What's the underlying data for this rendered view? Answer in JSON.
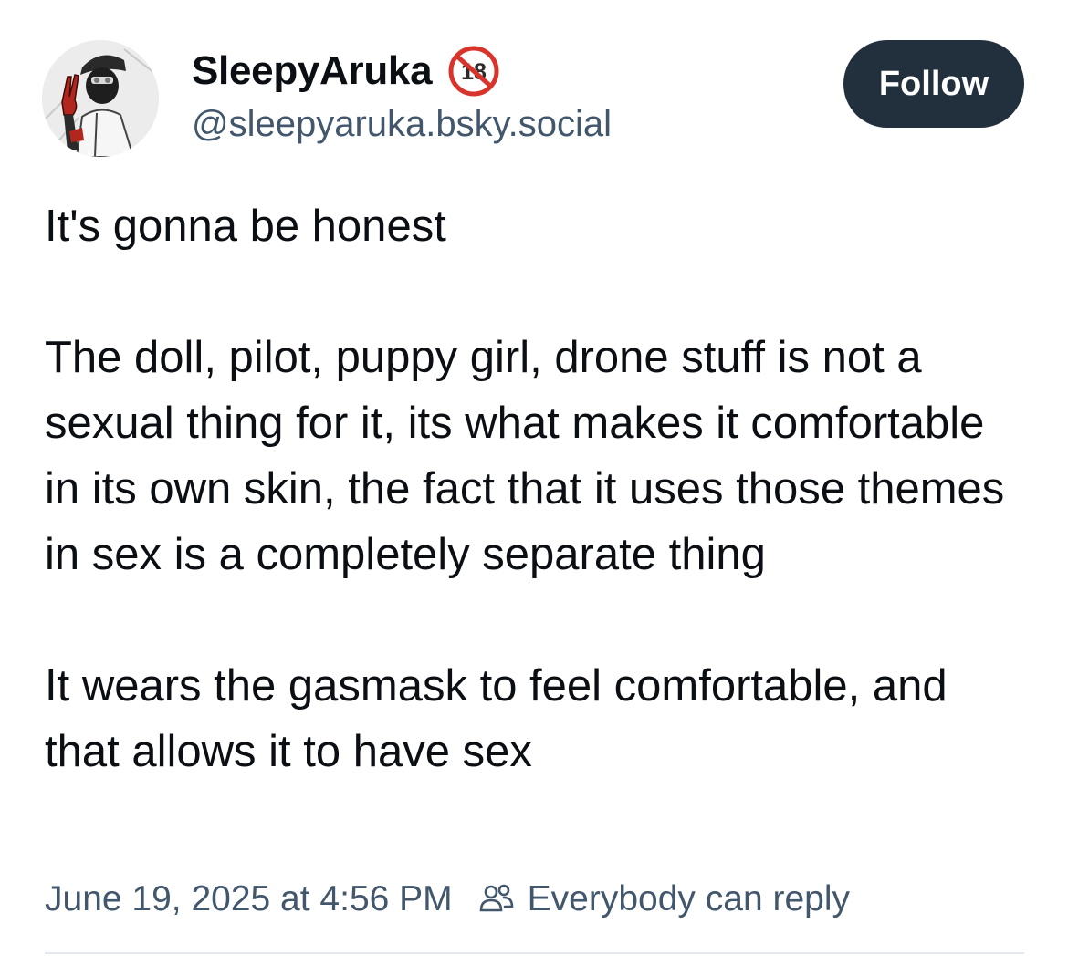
{
  "author": {
    "display_name": "SleepyAruka",
    "handle": "@sleepyaruka.bsky.social",
    "adult_badge": "18",
    "badge_icon": "no-under-18-icon",
    "avatar_icon": "avatar-masked-figure-peace-sign"
  },
  "follow_button": {
    "label": "Follow"
  },
  "post": {
    "paragraphs": [
      "It's gonna be honest",
      "The doll, pilot, puppy girl, drone stuff is not a sexual thing for it, its what makes it comfortable in its own skin, the fact that it uses those themes in sex is a completely separate thing",
      "It wears the gasmask to feel comfortable, and that allows it to have sex"
    ]
  },
  "meta": {
    "timestamp": "June 19, 2025 at 4:56 PM",
    "reply_setting": "Everybody can reply",
    "reply_icon": "people-icon"
  },
  "colors": {
    "text": "#0b0f14",
    "muted": "#42566c",
    "button_bg": "#222f3d",
    "badge_red": "#d9342b",
    "divider": "#e4e8ec"
  }
}
